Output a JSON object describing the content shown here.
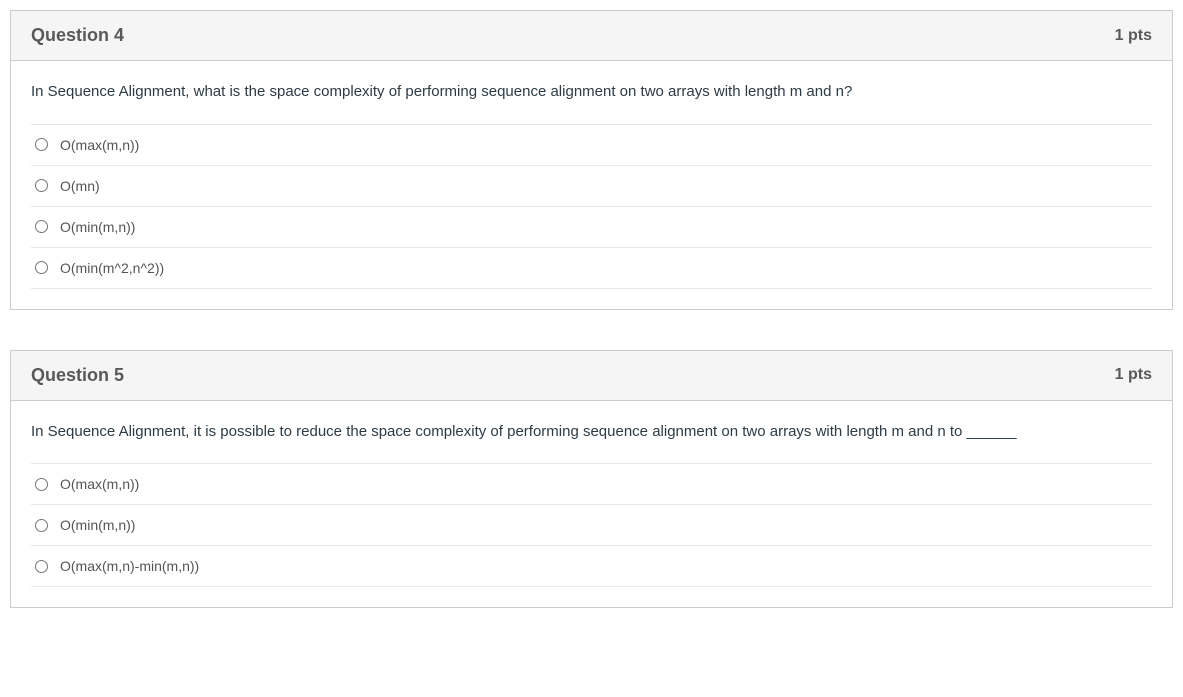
{
  "questions": [
    {
      "title": "Question 4",
      "points": "1 pts",
      "prompt": "In Sequence Alignment, what is the space complexity of performing sequence alignment on two arrays with length m and n?",
      "options": [
        "O(max(m,n))",
        "O(mn)",
        "O(min(m,n))",
        "O(min(m^2,n^2))"
      ]
    },
    {
      "title": "Question 5",
      "points": "1 pts",
      "prompt": "In Sequence Alignment, it is possible to reduce the space complexity of performing sequence alignment on two arrays with length m and n to ______",
      "options": [
        "O(max(m,n))",
        "O(min(m,n))",
        "O(max(m,n)-min(m,n))"
      ]
    }
  ]
}
